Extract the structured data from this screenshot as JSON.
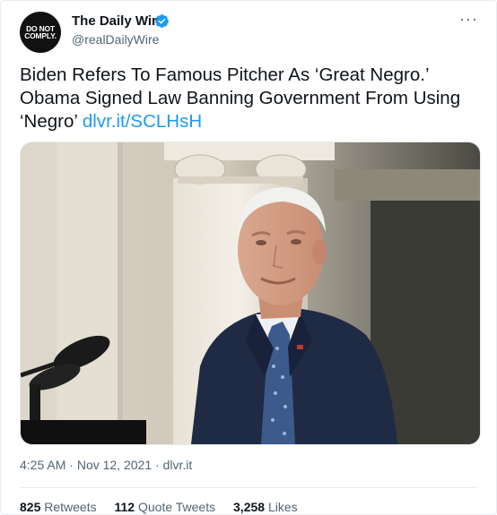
{
  "account": {
    "avatar_text": "DO NOT\nCOMPLY.",
    "name": "The Daily Wire",
    "handle": "@realDailyWire",
    "more_label": "···"
  },
  "tweet": {
    "text": "Biden Refers To Famous Pitcher As ‘Great Negro.’ Obama Signed Law Banning Government From Using ‘Negro’ ",
    "link_text": "dlvr.it/SCLHsH",
    "time": "4:25 AM",
    "date": "Nov 12, 2021",
    "source": "dlvr.it",
    "separator": " · "
  },
  "stats": {
    "retweets_count": "825",
    "retweets_label": "Retweets",
    "quotes_count": "112",
    "quotes_label": "Quote Tweets",
    "likes_count": "3,258",
    "likes_label": "Likes"
  },
  "colors": {
    "accent": "#1d9bf0",
    "text": "#0f1419",
    "muted": "#536471"
  },
  "icons": {
    "verified": "verified-badge-icon",
    "more": "more-dots-icon"
  }
}
